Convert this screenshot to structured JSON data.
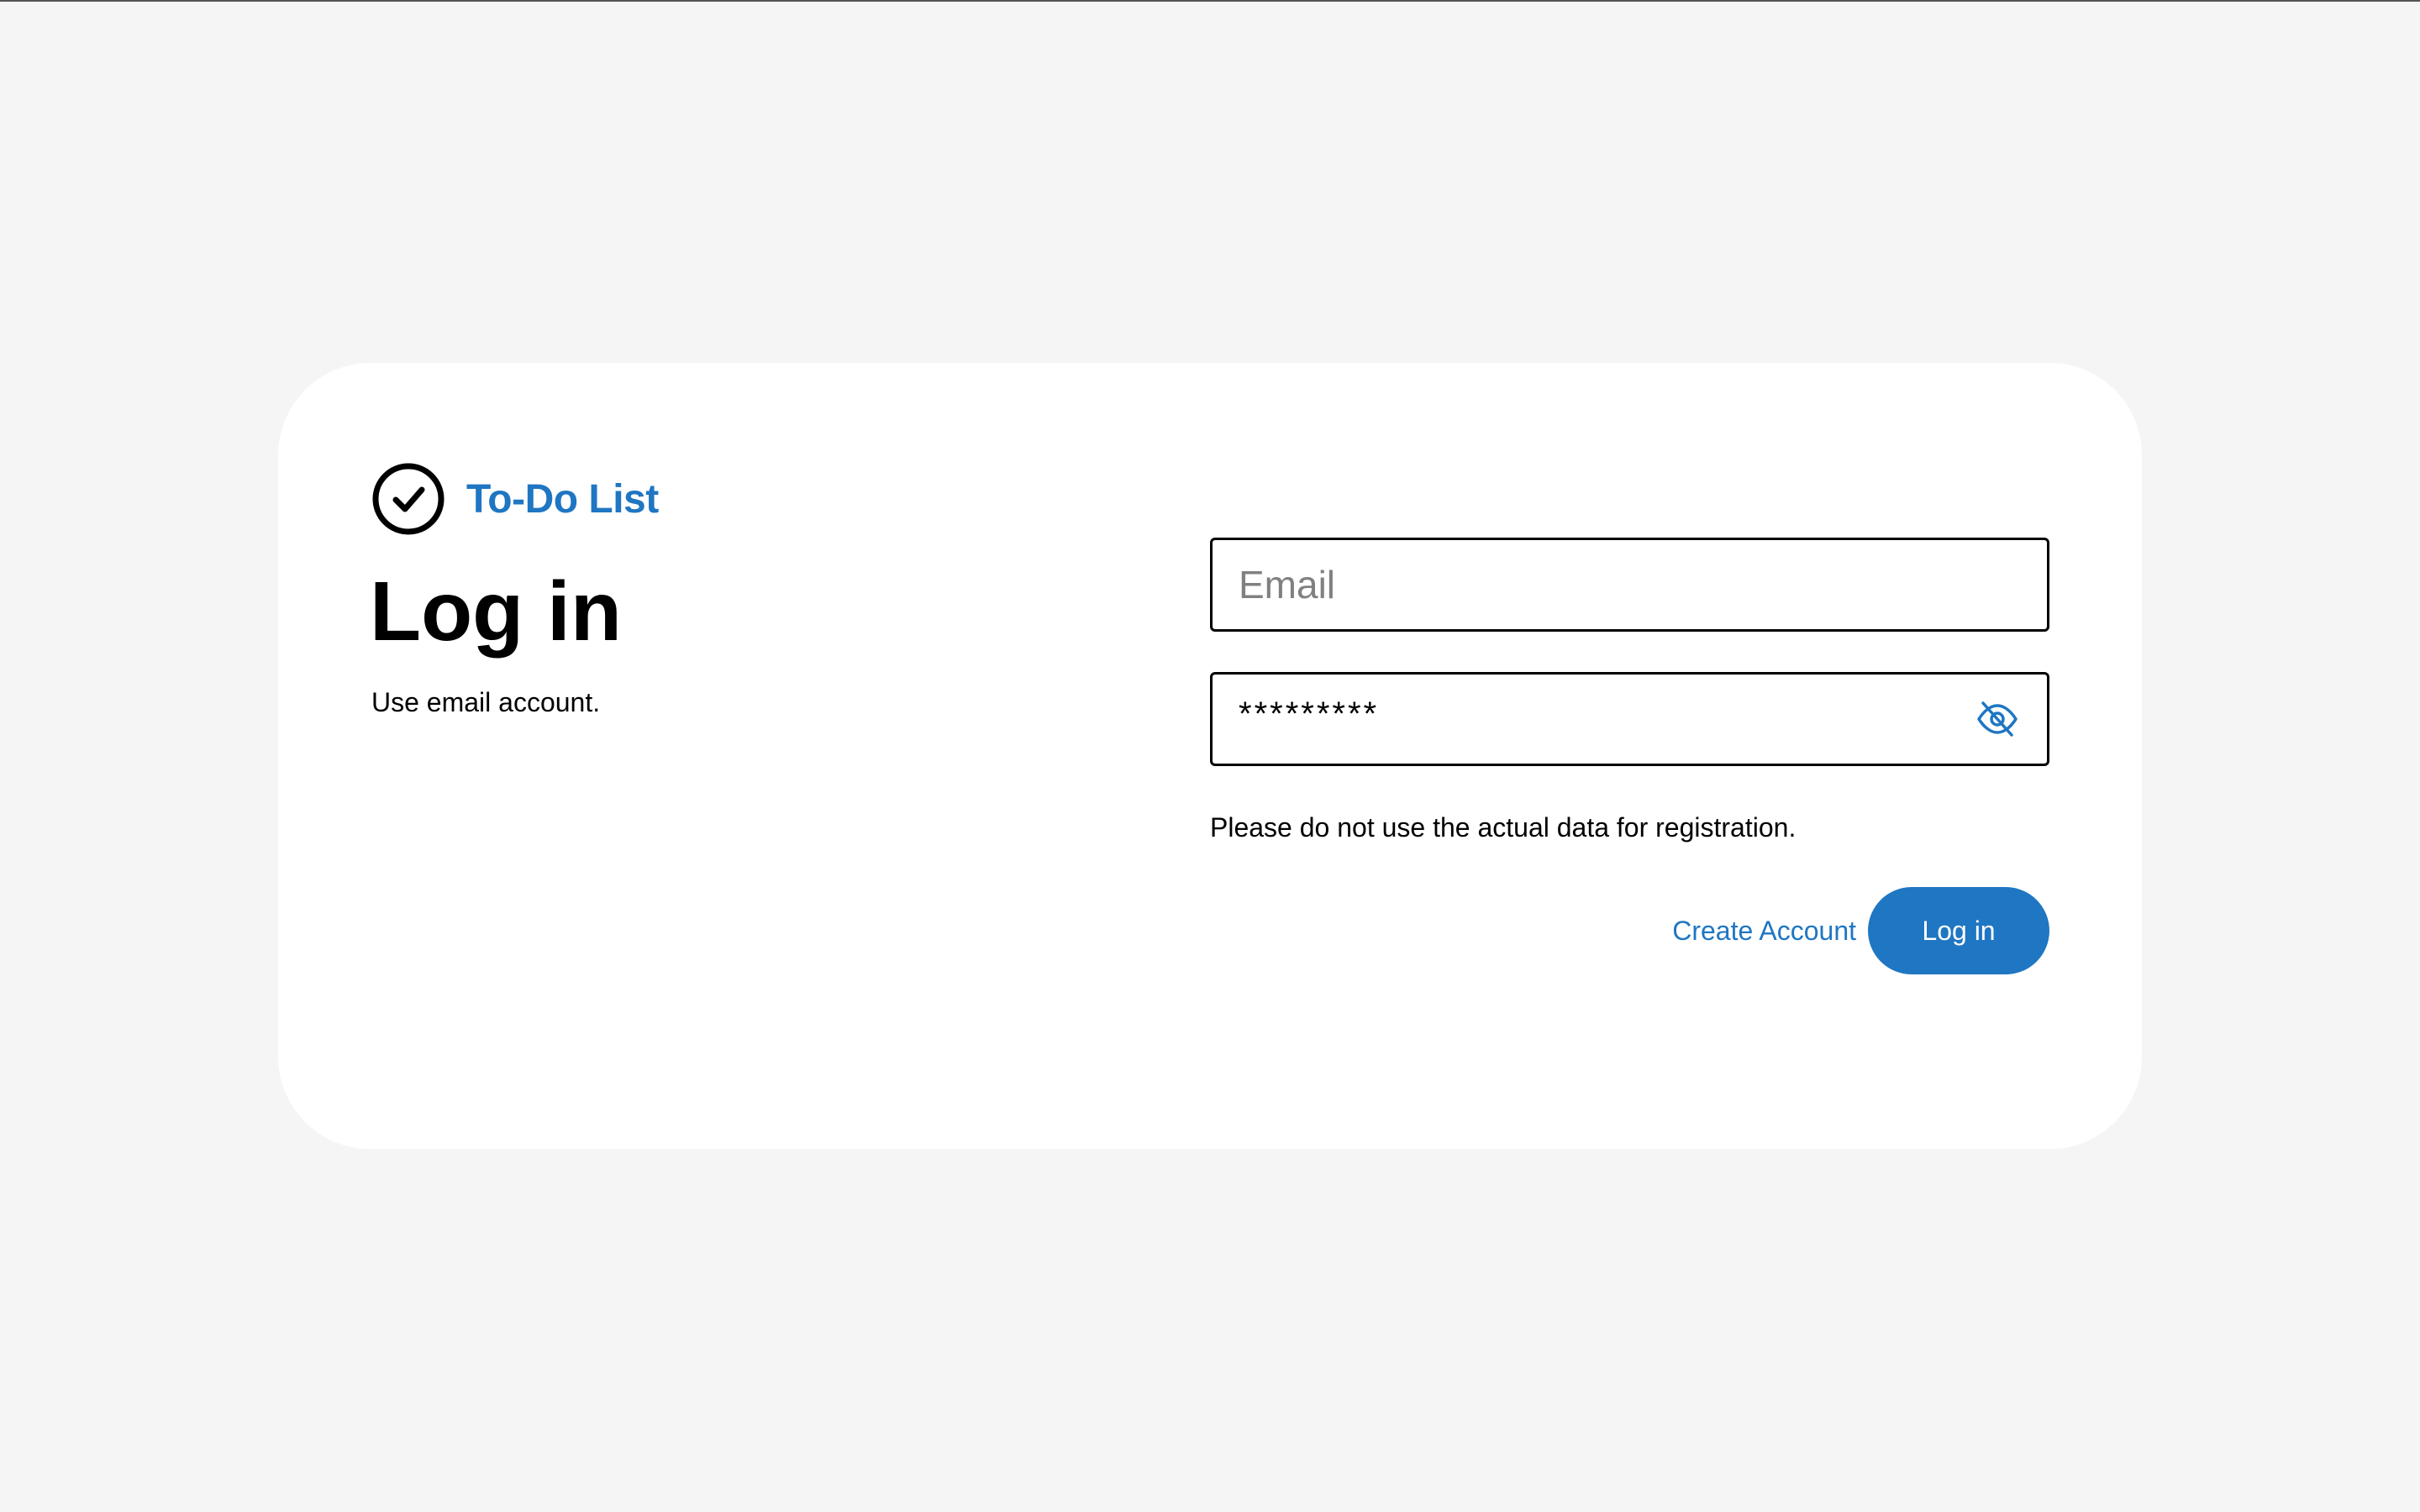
{
  "app": {
    "name": "To-Do List",
    "logo_icon": "check-circle-icon",
    "brand_color": "#1f76c2"
  },
  "login": {
    "title": "Log in",
    "subtitle": "Use email account.",
    "email": {
      "placeholder": "Email",
      "value": ""
    },
    "password": {
      "value": "*********",
      "visibility_icon": "eye-off-icon"
    },
    "notice": "Please do not use the actual data for registration.",
    "create_account_label": "Create Account",
    "submit_label": "Log in"
  }
}
